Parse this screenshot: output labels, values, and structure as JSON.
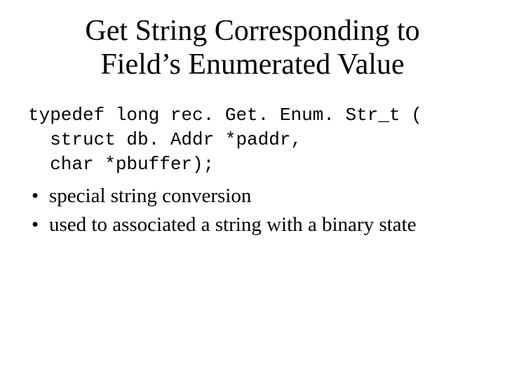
{
  "title_line1": "Get String Corresponding to",
  "title_line2": "Field’s Enumerated Value",
  "code": {
    "line1": "typedef long rec. Get. Enum. Str_t (",
    "line2": "  struct db. Addr *paddr,",
    "line3": "  char *pbuffer); "
  },
  "bullets": [
    "special string conversion",
    "used to associated a string with a binary state"
  ]
}
